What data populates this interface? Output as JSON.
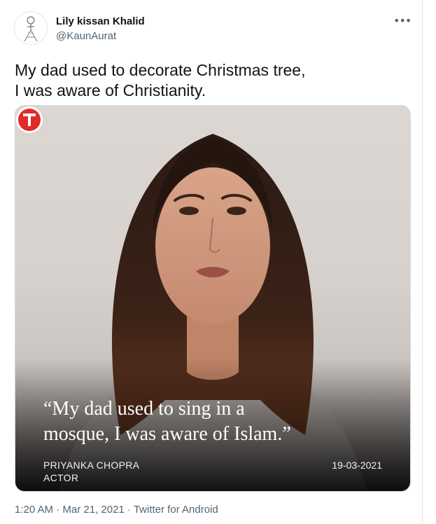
{
  "author": {
    "display_name": "Lily kissan Khalid",
    "handle": "@KaunAurat"
  },
  "tweet": {
    "text_lines": [
      "My dad used to decorate Christmas tree,",
      "I was aware of Christianity."
    ]
  },
  "media": {
    "logo_letter": "T",
    "logo_color": "#e02a2a",
    "quote_lines": [
      "“My dad used to sing in a",
      "mosque, I was aware of Islam.”"
    ],
    "person_name": "PRIYANKA CHOPRA",
    "person_role": "ACTOR",
    "date": "19-03-2021"
  },
  "meta": {
    "time": "1:20 AM",
    "separator": " · ",
    "date": "Mar 21, 2021",
    "source": "Twitter for Android"
  },
  "icons": {
    "more": "more-options-icon",
    "avatar": "avatar-sketch"
  }
}
